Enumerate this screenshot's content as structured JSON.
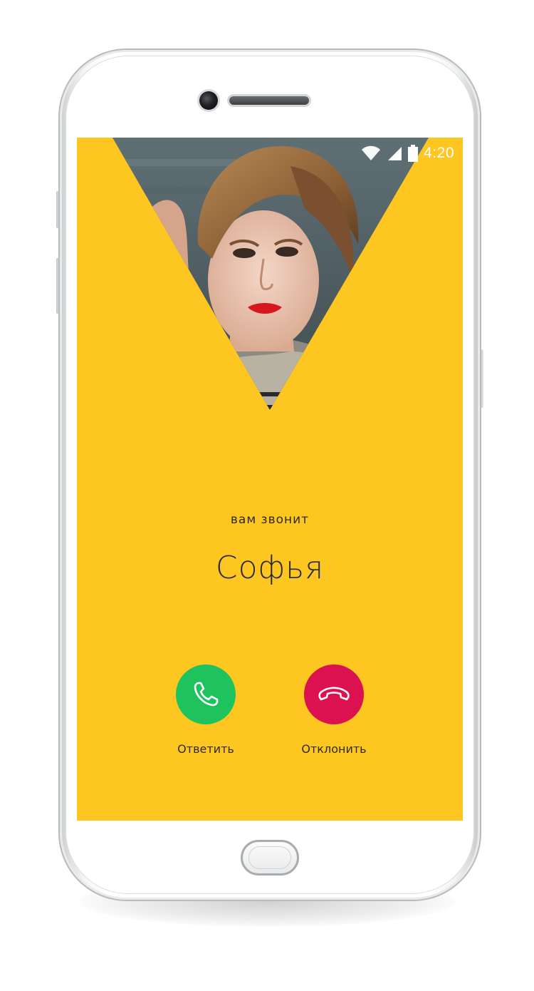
{
  "status_bar": {
    "time": "4:20",
    "wifi_icon": "wifi-icon",
    "signal_icon": "cellular-signal-icon",
    "battery_icon": "battery-icon"
  },
  "incoming_call": {
    "label": "вам звонит",
    "caller_name": "Софья",
    "caller_photo": "contact-photo"
  },
  "actions": {
    "answer": {
      "label": "Ответить",
      "icon": "phone-answer-icon",
      "color": "#1fc35e"
    },
    "decline": {
      "label": "Отклонить",
      "icon": "phone-hangup-icon",
      "color": "#dc1250"
    }
  },
  "theme": {
    "background": "#fec621",
    "text": "#2b2b2b"
  }
}
